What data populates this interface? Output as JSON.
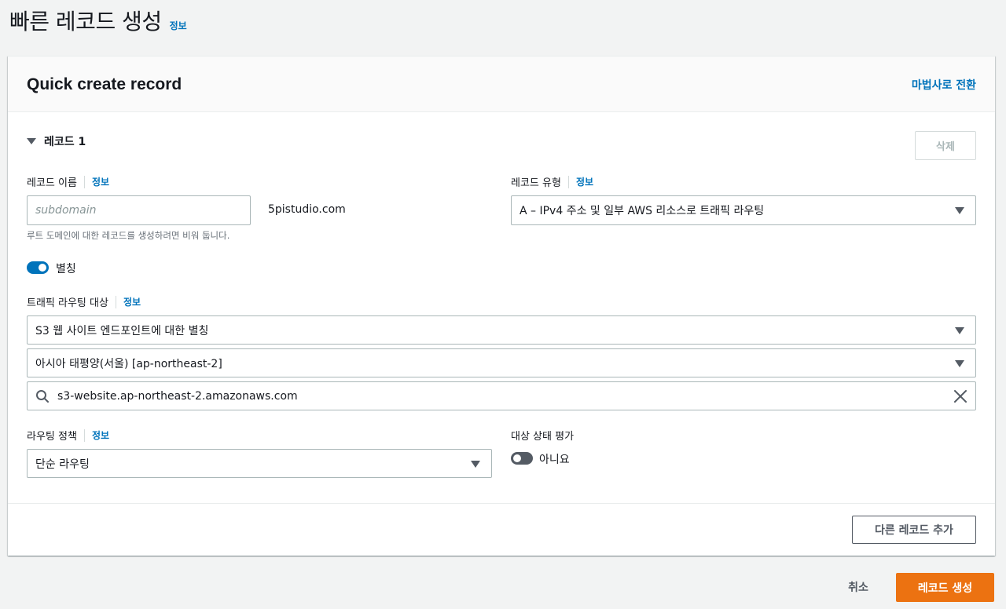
{
  "page": {
    "title": "빠른 레코드 생성",
    "info": "정보"
  },
  "panel": {
    "title": "Quick create record",
    "wizard_link": "마법사로 전환"
  },
  "record": {
    "title": "레코드 1",
    "delete_label": "삭제",
    "name": {
      "label": "레코드 이름",
      "info": "정보",
      "placeholder": "subdomain",
      "domain_suffix": "5pistudio.com",
      "hint": "루트 도메인에 대한 레코드를 생성하려면 비워 둡니다."
    },
    "type": {
      "label": "레코드 유형",
      "info": "정보",
      "value": "A – IPv4 주소 및 일부 AWS 리소스로 트래픽 라우팅"
    },
    "alias": {
      "label": "별칭",
      "enabled": true
    },
    "target": {
      "label": "트래픽 라우팅 대상",
      "info": "정보",
      "endpoint_type": "S3 웹 사이트 엔드포인트에 대한 별칭",
      "region": "아시아 태평양(서울) [ap-northeast-2]",
      "search_value": "s3-website.ap-northeast-2.amazonaws.com"
    },
    "routing_policy": {
      "label": "라우팅 정책",
      "info": "정보",
      "value": "단순 라우팅"
    },
    "health_check": {
      "label": "대상 상태 평가",
      "enabled": false,
      "value_label": "아니요"
    }
  },
  "actions": {
    "add_record": "다른 레코드 추가",
    "cancel": "취소",
    "create": "레코드 생성"
  },
  "colors": {
    "accent": "#0073bb",
    "primary_button": "#ec7211",
    "background": "#f2f3f3"
  }
}
